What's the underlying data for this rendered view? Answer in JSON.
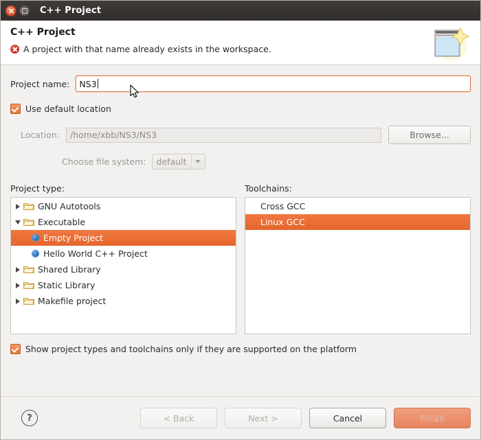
{
  "window": {
    "title": "C++ Project",
    "close_icon": "close-icon",
    "maximize_icon": "maximize-icon"
  },
  "header": {
    "title": "C++ Project",
    "message": "A project with that name already exists in the workspace.",
    "error_icon": "error-icon",
    "wizard_icon": "new-project-wizard-icon",
    "error_color": "#cc2a20"
  },
  "form": {
    "project_name_label": "Project name:",
    "project_name_value": "NS3",
    "project_name_placeholder": "",
    "use_default_location_label": "Use default location",
    "use_default_location_checked": true,
    "location_label": "Location:",
    "location_value": "/home/xbb/NS3/NS3",
    "browse_label": "Browse...",
    "file_system_label": "Choose file system:",
    "file_system_value": "default",
    "file_system_options": [
      "default"
    ]
  },
  "project_type": {
    "label": "Project type:",
    "items": [
      {
        "label": "GNU Autotools",
        "level": 1,
        "icon": "folder-icon",
        "twisty": "collapsed",
        "selected": false
      },
      {
        "label": "Executable",
        "level": 1,
        "icon": "folder-icon",
        "twisty": "expanded",
        "selected": false
      },
      {
        "label": "Empty Project",
        "level": 2,
        "icon": "project-dot-icon",
        "twisty": "none",
        "selected": true
      },
      {
        "label": "Hello World C++ Project",
        "level": 2,
        "icon": "project-dot-icon",
        "twisty": "none",
        "selected": false
      },
      {
        "label": "Shared Library",
        "level": 1,
        "icon": "folder-icon",
        "twisty": "collapsed",
        "selected": false
      },
      {
        "label": "Static Library",
        "level": 1,
        "icon": "folder-icon",
        "twisty": "collapsed",
        "selected": false
      },
      {
        "label": "Makefile project",
        "level": 1,
        "icon": "folder-icon",
        "twisty": "collapsed",
        "selected": false
      }
    ]
  },
  "toolchains": {
    "label": "Toolchains:",
    "items": [
      {
        "label": "Cross GCC",
        "selected": false
      },
      {
        "label": "Linux GCC",
        "selected": true
      }
    ]
  },
  "show_supported": {
    "label": "Show project types and toolchains only if they are supported on the platform",
    "checked": true
  },
  "footer": {
    "help_label": "?",
    "back_label": "< Back",
    "next_label": "Next >",
    "cancel_label": "Cancel",
    "finish_label": "Finish"
  },
  "colors": {
    "accent": "#e5652c",
    "selection": "#ed7338",
    "titlebar": "#3a3634"
  }
}
